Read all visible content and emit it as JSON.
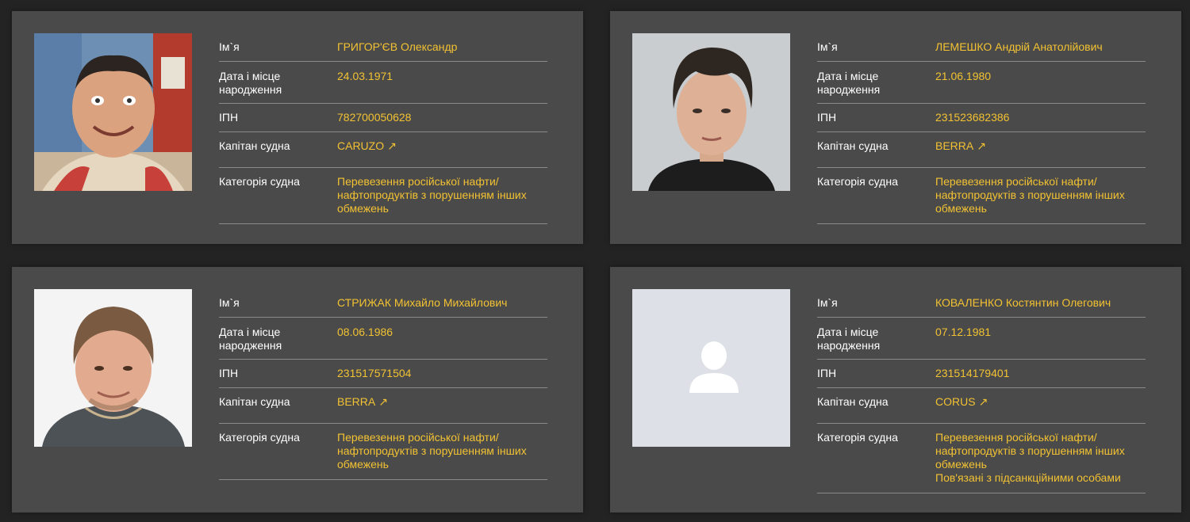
{
  "labels": {
    "name": "Ім`я",
    "birth_line1": "Дата і місце",
    "birth_line2": "народження",
    "tax_id": "ІПН",
    "captain": "Капітан судна",
    "category": "Категорія судна"
  },
  "cards": [
    {
      "name": "ГРИГОР'ЄВ Олександр",
      "birth": "24.03.1971",
      "tax_id": "782700050628",
      "vessel": "CARUZO",
      "category_lines": [
        "Перевезення російської нафти/",
        "нафтопродуктів з порушенням інших",
        "обмежень"
      ],
      "extra": ""
    },
    {
      "name": "ЛЕМЕШКО Андрій Анатолійович",
      "birth": "21.06.1980",
      "tax_id": "231523682386",
      "vessel": "BERRA",
      "category_lines": [
        "Перевезення російської нафти/",
        "нафтопродуктів з порушенням інших",
        "обмежень"
      ],
      "extra": ""
    },
    {
      "name": "СТРИЖАК Михайло Михайлович",
      "birth": "08.06.1986",
      "tax_id": "231517571504",
      "vessel": "BERRA",
      "category_lines": [
        "Перевезення російської нафти/",
        "нафтопродуктів з порушенням інших",
        "обмежень"
      ],
      "extra": ""
    },
    {
      "name": "КОВАЛЕНКО Костянтин Олегович",
      "birth": "07.12.1981",
      "tax_id": "231514179401",
      "vessel": "CORUS",
      "category_lines": [
        "Перевезення російської нафти/",
        "нафтопродуктів з порушенням інших",
        "обмежень"
      ],
      "extra": "Пов'язані з підсанкційними особами"
    }
  ],
  "icons": {
    "external_link": "↗",
    "placeholder": "person-placeholder-icon"
  },
  "colors": {
    "accent": "#f2c232",
    "card_bg": "#4a4a4a",
    "page_bg": "#232323"
  }
}
